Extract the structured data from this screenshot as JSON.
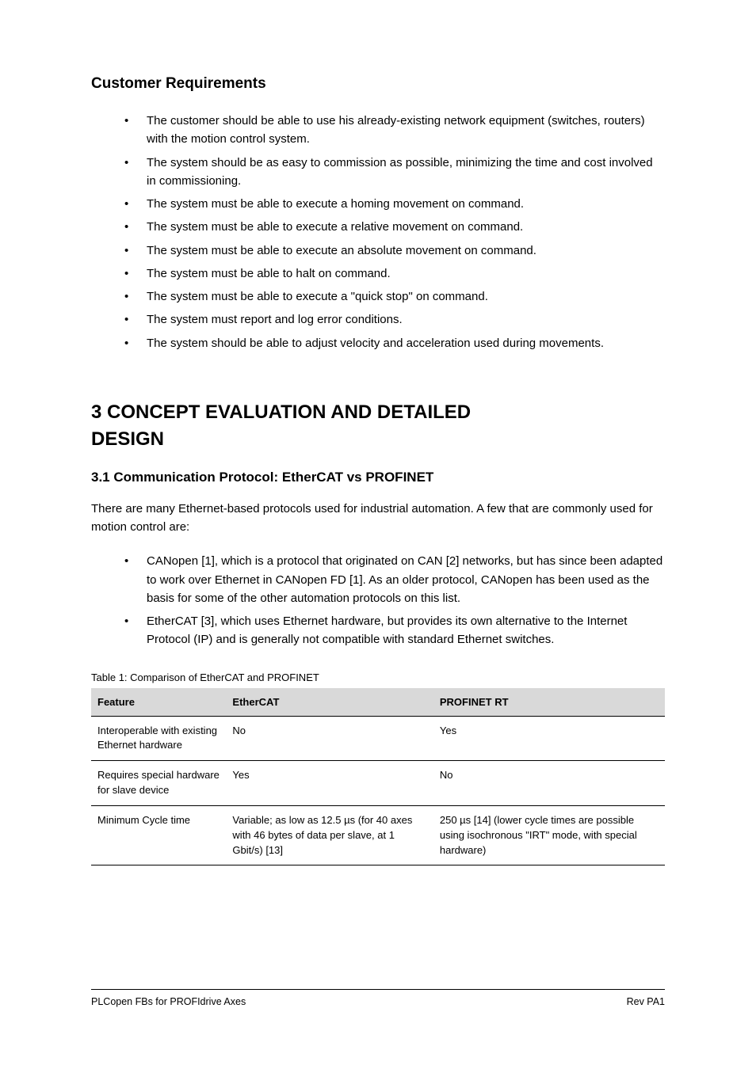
{
  "heading_main": "Customer Requirements",
  "bullets_1": [
    "The customer should be able to use his already-existing network equipment (switches, routers) with the motion control system.",
    "The system should be as easy to commission as possible, minimizing the time and cost involved in commissioning.",
    "The system must be able to execute a homing movement on command.",
    "The system must be able to execute a relative movement on command.",
    "The system must be able to execute an absolute movement on command.",
    "The system must be able to halt on command.",
    "The system must be able to execute a \"quick stop\" on command.",
    "The system must report and log error conditions.",
    "The system should be able to adjust velocity and acceleration used during movements."
  ],
  "section_heading_line1": "3 CONCEPT EVALUATION AND DETAILED",
  "section_heading_line2": "DESIGN",
  "subsection_heading": "3.1 Communication Protocol: EtherCAT vs PROFINET",
  "paragraph_intro": "There are many Ethernet-based protocols used for industrial automation. A few that are commonly used for motion control are:",
  "bullets_2": [
    "CANopen [1], which is a protocol that originated on CAN [2] networks, but has since been adapted to work over Ethernet in CANopen FD [1]. As an older protocol, CANopen has been used as the basis for some of the other automation protocols on this list.",
    "EtherCAT [3], which uses Ethernet hardware, but provides its own alternative to the Internet Protocol (IP) and is generally not compatible with standard Ethernet switches."
  ],
  "table_caption": "Table 1: Comparison of EtherCAT and PROFINET",
  "table": {
    "headers": [
      "Feature",
      "EtherCAT",
      "PROFINET RT"
    ],
    "rows": [
      [
        "Interoperable with existing Ethernet hardware",
        "No",
        "Yes"
      ],
      [
        "Requires special hardware for slave device",
        "Yes",
        "No"
      ],
      [
        "Minimum Cycle time",
        "Variable; as low as 12.5 µs (for 40 axes with 46 bytes of data per slave, at 1 Gbit/s) [13]",
        "250 µs [14] (lower cycle times are possible using isochronous \"IRT\" mode, with special hardware)"
      ]
    ]
  },
  "footer": {
    "left": "PLCopen FBs for PROFIdrive Axes",
    "right": "Rev PA1"
  }
}
